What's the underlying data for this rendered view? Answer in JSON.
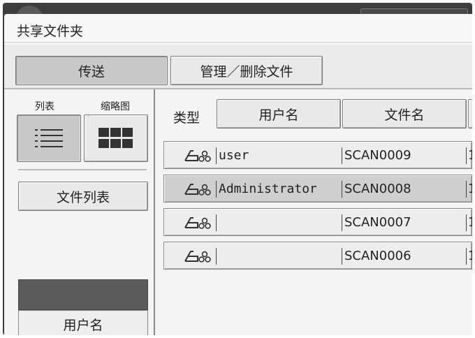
{
  "window": {
    "title": "共享文件夹"
  },
  "tabs": {
    "send_label": "传送",
    "manage_label": "管理／删除文件"
  },
  "view_toggle": {
    "list_label": "列表",
    "thumbnail_label": "缩略图"
  },
  "left": {
    "file_list_label": "文件列表",
    "username_label": "用户名"
  },
  "columns": {
    "type_label": "类型",
    "user_label": "用户名",
    "file_label": "文件名"
  },
  "files": [
    {
      "type_icon": "scanner-icon",
      "user": "user",
      "file": "SCAN0009",
      "trailing": "1",
      "selected": false
    },
    {
      "type_icon": "scanner-icon",
      "user": "Administrator",
      "file": "SCAN0008",
      "trailing": "1",
      "selected": true
    },
    {
      "type_icon": "scanner-icon",
      "user": "",
      "file": "SCAN0007",
      "trailing": "1",
      "selected": false
    },
    {
      "type_icon": "scanner-icon",
      "user": "",
      "file": "SCAN0006",
      "trailing": "1",
      "selected": false
    }
  ]
}
